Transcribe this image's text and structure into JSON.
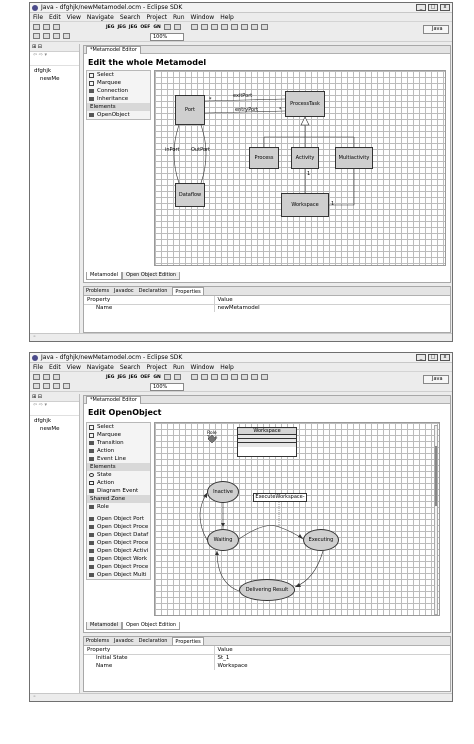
{
  "window1": {
    "title": "Java - dfghjk/newMetamodel.ocm - Eclipse SDK",
    "menu": [
      "File",
      "Edit",
      "View",
      "Navigate",
      "Search",
      "Project",
      "Run",
      "Window",
      "Help"
    ],
    "toolbar_labels": [
      "JEG",
      "JEG",
      "JEG",
      "OEF",
      "GN"
    ],
    "zoom": "100%",
    "perspective": "Java",
    "tree": {
      "project": "dfghjk",
      "file": "newMe"
    },
    "editor_tab": "*Metamodel Editor",
    "diagram_title": "Edit the whole Metamodel",
    "palette": {
      "tools": [
        "Select",
        "Marquee"
      ],
      "connections": [
        "Connection",
        "Inheritance"
      ],
      "elements_header": "Elements",
      "elements": [
        "OpenObject"
      ]
    },
    "nodes": {
      "port": "Port",
      "processtask": "ProcessTask",
      "process": "Process",
      "activity": "Activity",
      "multiactivity": "Multiactivity",
      "dataflow": "Dataflow",
      "workspace": "Workspace"
    },
    "edge_labels": {
      "exitport": "exitPort",
      "entryport": "entryPort",
      "inport": "inPort",
      "outport": "OutPort",
      "star1": "*",
      "star2": "*",
      "one1": "1",
      "one2": "1"
    },
    "bottom_tabs": [
      "Metamodel",
      "Open Object Edition"
    ],
    "props_tabs": [
      "Problems",
      "Javadoc",
      "Declaration",
      "Properties"
    ],
    "props_header": [
      "Property",
      "Value"
    ],
    "props_rows": [
      {
        "property": "Name",
        "value": "newMetamodel"
      }
    ]
  },
  "window2": {
    "title": "Java - dfghjk/newMetamodel.ocm - Eclipse SDK",
    "menu": [
      "File",
      "Edit",
      "View",
      "Navigate",
      "Search",
      "Project",
      "Run",
      "Window",
      "Help"
    ],
    "toolbar_labels": [
      "JEG",
      "JEG",
      "JEG",
      "OEF",
      "GN"
    ],
    "zoom": "100%",
    "perspective": "Java",
    "tree": {
      "project": "dfghjk",
      "file": "newMe"
    },
    "editor_tab": "*Metamodel Editor",
    "diagram_title": "Edit OpenObject",
    "palette": {
      "tools": [
        "Select",
        "Marquee"
      ],
      "connections": [
        "Transition",
        "Action",
        "Event Line"
      ],
      "elements_header": "Elements",
      "elements": [
        "State",
        "Action",
        "Diagram Event"
      ],
      "shared_header": "Shared Zone",
      "shared": [
        "Role"
      ],
      "open_objects": [
        "Open Object Port",
        "Open Object Proce",
        "Open Object Dataf",
        "Open Object Proce",
        "Open Object Activi",
        "Open Object Work",
        "Open Object Proce",
        "Open Object Multi"
      ]
    },
    "role_label": "Role Type",
    "workspace_box": "Workspace",
    "states": {
      "inactive": "Inactive",
      "waiting": "Waiting",
      "executing": "Executing",
      "delivering": "Delivering Result"
    },
    "action_box": "ExecuteWorkspace-",
    "bottom_tabs": [
      "Metamodel",
      "Open Object Edition"
    ],
    "props_tabs": [
      "Problems",
      "Javadoc",
      "Declaration",
      "Properties"
    ],
    "props_header": [
      "Property",
      "Value"
    ],
    "props_rows": [
      {
        "property": "Initial State",
        "value": "St_1"
      },
      {
        "property": "Name",
        "value": "Workspace"
      }
    ]
  }
}
